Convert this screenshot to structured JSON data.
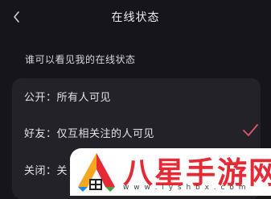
{
  "nav": {
    "back_icon": "chevron-left-icon",
    "title": "在线状态"
  },
  "section": {
    "title": "谁可以看见我的在线状态"
  },
  "options": [
    {
      "label": "公开：所有人可见",
      "selected": false
    },
    {
      "label": "好友：仅互相关注的人可见",
      "selected": true
    },
    {
      "label": "关闭：关",
      "selected": false
    }
  ],
  "check_icon": "checkmark-icon",
  "colors": {
    "background": "#15151a",
    "card": "#222228",
    "check": "#e0566c",
    "watermark_text": "#e62a35"
  },
  "watermark": {
    "name": "八星手游网",
    "url": "w w w . l y s h b x . c o m"
  }
}
